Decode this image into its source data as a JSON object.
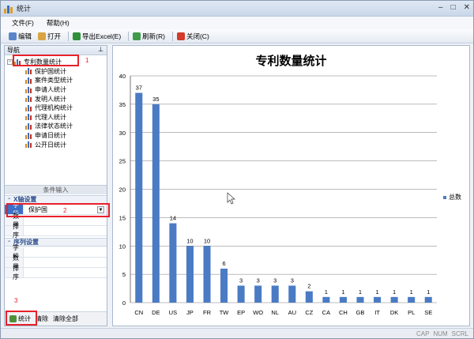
{
  "window": {
    "title": "统计",
    "controls": [
      "–",
      "□",
      "✕"
    ]
  },
  "menu": [
    "文件(F)",
    "帮助(H)"
  ],
  "toolbar": {
    "edit": "编辑",
    "open": "打开",
    "export": "导出Excel(E)",
    "refresh": "刷新(R)",
    "close": "关闭(C)"
  },
  "nav": {
    "title": "导航",
    "root": "专利数量统计",
    "items": [
      "保护国统计",
      "案件类型统计",
      "申请人统计",
      "发明人统计",
      "代理机构统计",
      "代理人统计",
      "法律状态统计",
      "申请日统计",
      "公开日统计"
    ]
  },
  "conditions": {
    "title": "条件输入",
    "x_group": "X轴设置",
    "x_field_label": "字段",
    "x_field_value": "保护国",
    "x_count_label": "数量",
    "x_sort_label": "排序",
    "series_group": "序列设置",
    "s_field_label": "字段",
    "s_count_label": "数量",
    "s_sort_label": "排序"
  },
  "bottom": {
    "stat": "统计",
    "clear": "清除",
    "clear_all": "清除全部"
  },
  "annotations": {
    "a1": "1",
    "a2": "2",
    "a3": "3"
  },
  "status": [
    "CAP",
    "NUM",
    "SCRL"
  ],
  "colors": {
    "bar": "#4a7bc4",
    "highlight": "#e8202a"
  },
  "chart_data": {
    "type": "bar",
    "title": "专利数量统计",
    "categories": [
      "CN",
      "DE",
      "US",
      "JP",
      "FR",
      "TW",
      "EP",
      "WO",
      "NL",
      "AU",
      "CZ",
      "CA",
      "CH",
      "GB",
      "IT",
      "DK",
      "PL",
      "SE"
    ],
    "series": [
      {
        "name": "总数",
        "values": [
          37,
          35,
          14,
          10,
          10,
          6,
          3,
          3,
          3,
          3,
          2,
          1,
          1,
          1,
          1,
          1,
          1,
          1
        ]
      }
    ],
    "ylim": [
      0,
      40
    ],
    "yticks": [
      0,
      5,
      10,
      15,
      20,
      25,
      30,
      35,
      40
    ],
    "grid": true,
    "legend": "right"
  }
}
